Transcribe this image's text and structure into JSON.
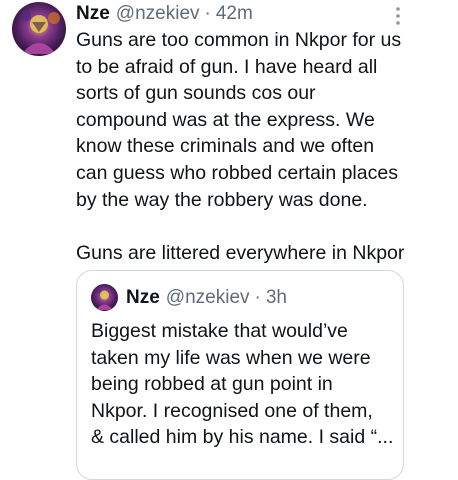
{
  "tweet": {
    "display_name": "Nze",
    "handle": "@nzekiev",
    "separator": "·",
    "time": "42m",
    "body_lines": [
      "Guns are too common in Nkpor for us",
      "to be afraid of gun. I have heard all",
      "sorts of gun sounds cos our",
      "compound was at the express. We",
      "know these criminals and we often",
      "can guess who robbed certain places",
      "by the way the robbery was done."
    ],
    "body_last_line": "Guns are littered everywhere in Nkpor",
    "more_icon": "more-vertical-icon"
  },
  "quoted_tweet": {
    "display_name": "Nze",
    "handle": "@nzekiev",
    "separator": "·",
    "time": "3h",
    "body_lines": [
      "Biggest mistake that would’ve",
      "taken my life was when we were",
      "being robbed at gun point in",
      "Nkpor. I recognised one of them,",
      "& called him by his name. I said “..."
    ]
  },
  "colors": {
    "text_primary": "#0f1419",
    "text_secondary": "#606b76",
    "border": "#cfd9de",
    "background": "#ffffff"
  }
}
